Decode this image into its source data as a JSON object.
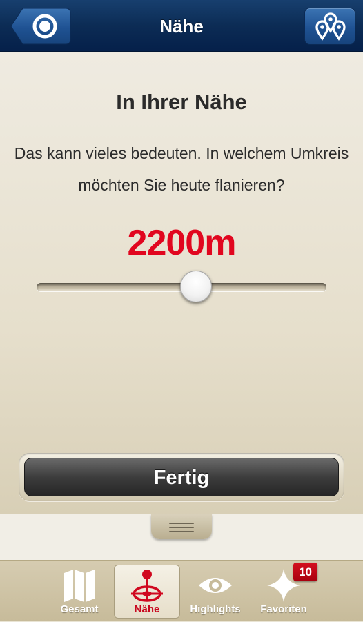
{
  "header": {
    "title": "Nähe",
    "back_icon": "target-icon",
    "map_icon": "map-pins-icon"
  },
  "main": {
    "heading": "In Ihrer Nähe",
    "description": "Das kann vieles bedeuten. In welchem Umkreis möchten Sie heute flanieren?",
    "distance_value": "2200m",
    "slider_value_fraction": 0.55,
    "done_label": "Fertig"
  },
  "tabbar": {
    "tabs": [
      {
        "label": "Gesamt",
        "icon": "map-icon",
        "active": false
      },
      {
        "label": "Nähe",
        "icon": "location-pin-icon",
        "active": true
      },
      {
        "label": "Highlights",
        "icon": "eye-icon",
        "active": false
      },
      {
        "label": "Favoriten",
        "icon": "star-icon",
        "active": false
      }
    ],
    "favorites_badge": "10"
  },
  "colors": {
    "navbar": "#0c2c55",
    "accent_red": "#e1061f",
    "background": "#e9e4d4",
    "tab_label": "#ffffff"
  }
}
